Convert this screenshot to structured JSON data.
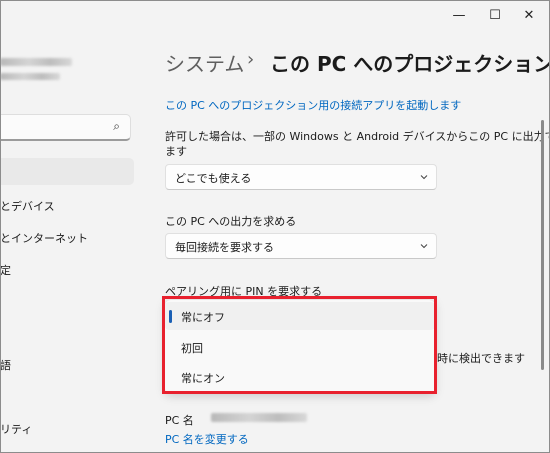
{
  "window": {
    "minimize_glyph": "—",
    "maximize_glyph": "☐",
    "close_glyph": "✕"
  },
  "sidebar": {
    "items": [
      {
        "label": "とデバイス"
      },
      {
        "label": "とインターネット"
      },
      {
        "label": "定"
      },
      {
        "label": "語"
      },
      {
        "label": "リティ"
      }
    ]
  },
  "header": {
    "parent": "システム",
    "separator": "›",
    "current": "この PC へのプロジェクション"
  },
  "content": {
    "launch_link": "この PC へのプロジェクション用の接続アプリを起動します",
    "permission_label_line1": "許可した場合は、一部の Windows と Android デバイスからこの PC に出力でき",
    "permission_label_line2": "ます",
    "permission_value": "どこでも使える",
    "request_label": "この PC への出力を求める",
    "request_value": "毎回接続を要求する",
    "pin_label": "ペアリング用に PIN を要求する",
    "pin_options": [
      {
        "label": "常にオフ",
        "selected": true
      },
      {
        "label": "初回",
        "selected": false
      },
      {
        "label": "常にオン",
        "selected": false
      }
    ],
    "obscured_text": "時に検出できます",
    "pc_name_label": "PC 名",
    "rename_link": "PC 名を変更する"
  },
  "colors": {
    "accent": "#0067c0",
    "highlight": "#e8212e",
    "selection_bar": "#1a5fb4"
  }
}
